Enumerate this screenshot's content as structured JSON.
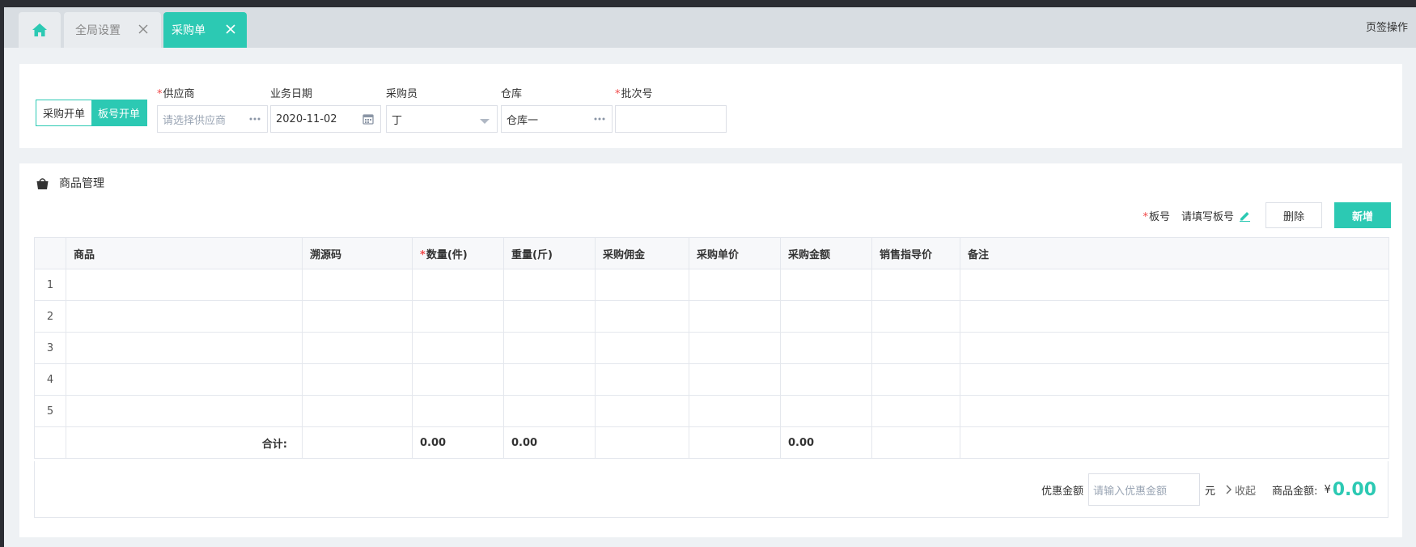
{
  "colors": {
    "accent": "#2cc9b3",
    "required": "#f04848"
  },
  "tabs": {
    "home_icon": "home-icon",
    "items": [
      {
        "label": "全局设置",
        "active": false
      },
      {
        "label": "采购单",
        "active": true
      }
    ],
    "page_ops": "页签操作"
  },
  "form": {
    "mode": {
      "off_label": "采购开单",
      "on_label": "板号开单"
    },
    "supplier": {
      "label": "供应商",
      "placeholder": "请选择供应商",
      "required": true
    },
    "biz_date": {
      "label": "业务日期",
      "value": "2020-11-02"
    },
    "buyer": {
      "label": "采购员",
      "value": "丁"
    },
    "warehouse": {
      "label": "仓库",
      "value": "仓库一"
    },
    "batch_no": {
      "label": "批次号",
      "value": "",
      "required": true
    }
  },
  "goods": {
    "title": "商品管理",
    "board_label": "板号",
    "board_fill": "请填写板号",
    "delete_label": "删除",
    "add_label": "新增",
    "columns": [
      "商品",
      "溯源码",
      "数量(件)",
      "重量(斤)",
      "采购佣金",
      "采购单价",
      "采购金额",
      "销售指导价",
      "备注"
    ],
    "rows": [
      "1",
      "2",
      "3",
      "4",
      "5"
    ],
    "totals": {
      "label": "合计:",
      "qty": "0.00",
      "weight": "0.00",
      "amount": "0.00"
    },
    "footer": {
      "discount_label": "优惠金额",
      "discount_placeholder": "请输入优惠金额",
      "unit": "元",
      "collapse_label": "收起",
      "goods_amount_label": "商品金额:",
      "currency": "¥",
      "goods_amount_value": "0.00"
    }
  }
}
